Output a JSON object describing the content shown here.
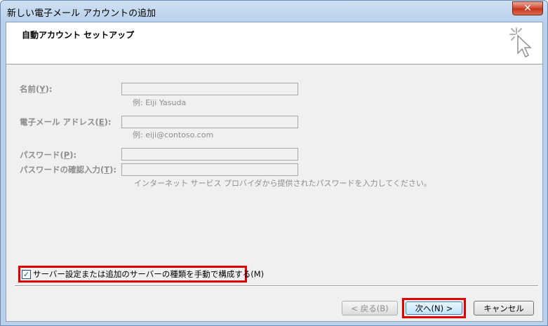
{
  "window": {
    "title": "新しい電子メール アカウントの追加",
    "close_label": "✕"
  },
  "header": {
    "title": "自動アカウント セットアップ"
  },
  "form": {
    "name": {
      "label_pre": "名前(",
      "hotkey": "Y",
      "label_post": "):",
      "hint": "例: Eiji Yasuda"
    },
    "email": {
      "label_pre": "電子メール アドレス(",
      "hotkey": "E",
      "label_post": "):",
      "hint": "例: eiji@contoso.com"
    },
    "password": {
      "label_pre": "パスワード(",
      "hotkey": "P",
      "label_post": "):"
    },
    "password_confirm": {
      "label_pre": "パスワードの確認入力(",
      "hotkey": "T",
      "label_post": "):"
    },
    "password_hint": "インターネット サービス プロバイダから提供されたパスワードを入力してください。"
  },
  "manual_setup": {
    "label": "サーバー設定または追加のサーバーの種類を手動で構成する(M)",
    "checked": true,
    "check_glyph": "✓"
  },
  "buttons": {
    "back": "< 戻る(B)",
    "next": "次へ(N) >",
    "cancel": "キャンセル"
  }
}
